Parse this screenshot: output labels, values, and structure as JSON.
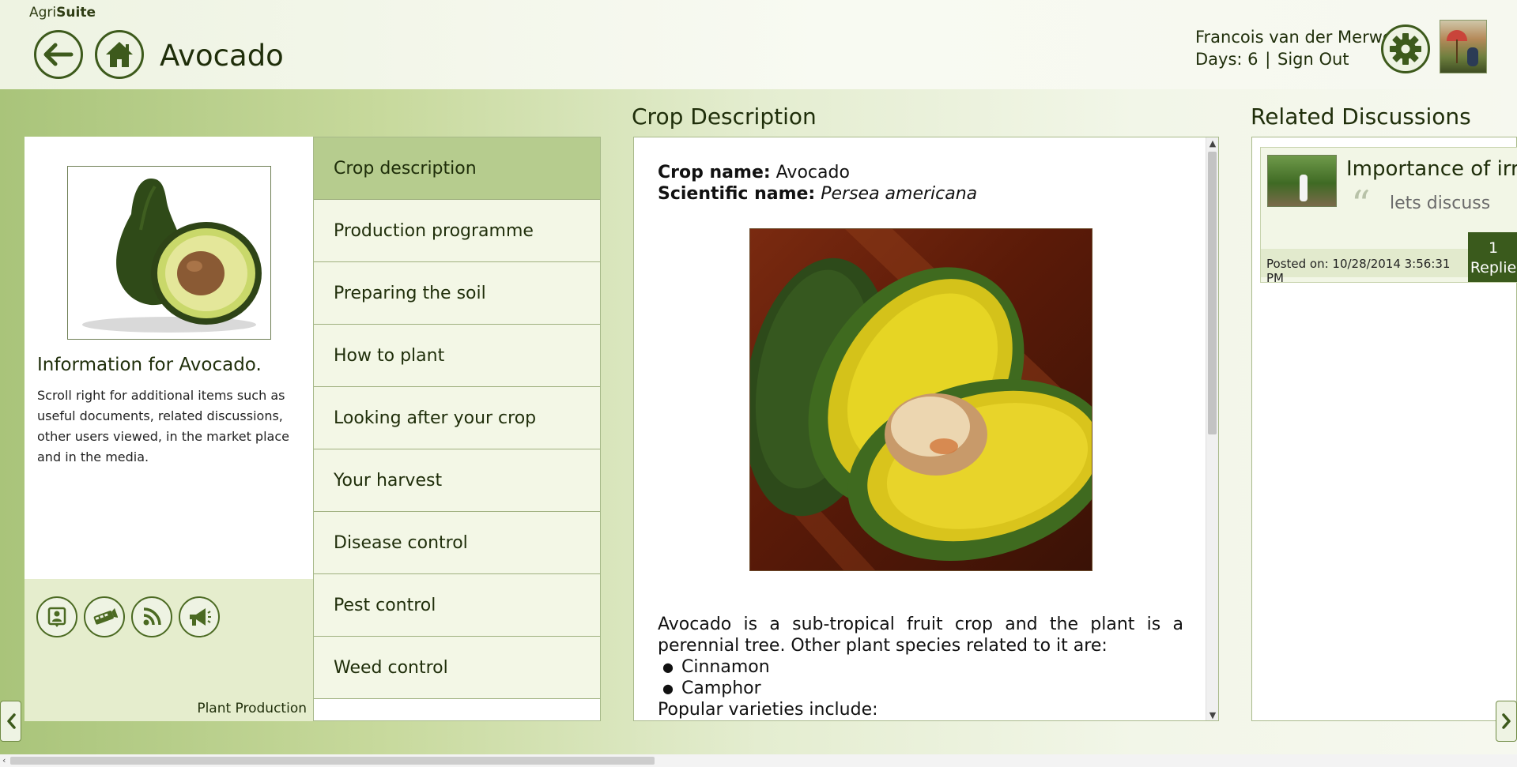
{
  "app": {
    "brand_prefix": "Agri",
    "brand_suffix": "Suite"
  },
  "header": {
    "title": "Avocado",
    "user_name": "Francois van der Merwe",
    "days_label": "Days: 6",
    "separator": "|",
    "sign_out": "Sign Out"
  },
  "icons": {
    "back": "arrow-left-icon",
    "home": "home-icon",
    "settings": "gear-icon"
  },
  "info_card": {
    "heading": "Information for Avocado.",
    "text": "Scroll right for additional items such as useful documents, related discussions, other users viewed, in the market place and in the media.",
    "footer_label": "Plant Production",
    "foot_icons": [
      "contact-card-icon",
      "film-icon",
      "rss-icon",
      "megaphone-icon"
    ]
  },
  "menu": {
    "items": [
      {
        "label": "Crop description",
        "active": true
      },
      {
        "label": "Production programme"
      },
      {
        "label": "Preparing the soil"
      },
      {
        "label": "How to plant"
      },
      {
        "label": "Looking after your crop"
      },
      {
        "label": "Your harvest"
      },
      {
        "label": "Disease control"
      },
      {
        "label": "Pest control"
      },
      {
        "label": "Weed control"
      }
    ]
  },
  "description": {
    "section_title": "Crop Description",
    "crop_name_label": "Crop name:",
    "crop_name": "Avocado",
    "scientific_label": "Scientific name:",
    "scientific_name": "Persea americana",
    "body": "Avocado is a sub-tropical fruit crop and the plant is a perennial tree. Other plant species related to it are:",
    "related": [
      "Cinnamon",
      "Camphor"
    ],
    "varieties_heading": "Popular varieties include:"
  },
  "discussions": {
    "section_title": "Related Discussions",
    "items": [
      {
        "title": "Importance of irr...",
        "snippet": "lets discuss",
        "posted": "Posted on: 10/28/2014 3:56:31 PM",
        "replies_count": "1",
        "replies_label": "Replie"
      }
    ]
  },
  "colors": {
    "accent_dark": "#3d5a1c",
    "menu_active": "#b6cc8e",
    "menu_bg": "#f3f7e6",
    "band_start": "#a9c47a",
    "band_end": "#f6f8ef"
  }
}
